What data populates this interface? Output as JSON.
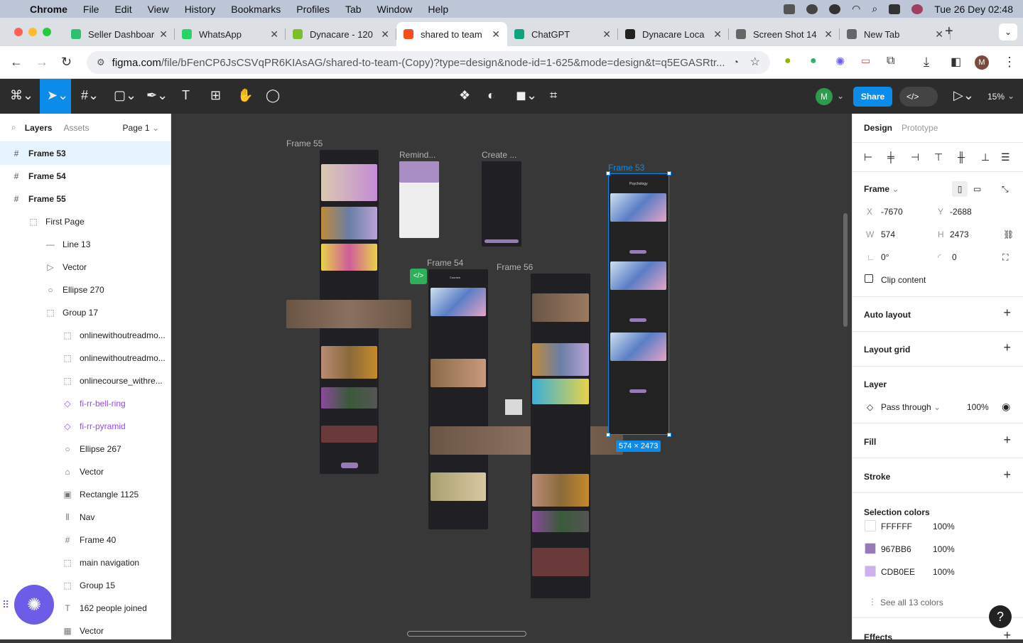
{
  "menubar": {
    "app": "Chrome",
    "items": [
      "File",
      "Edit",
      "View",
      "History",
      "Bookmarks",
      "Profiles",
      "Tab",
      "Window",
      "Help"
    ],
    "clock": "Tue 26 Dey  02:48"
  },
  "tabs": [
    {
      "title": "Seller Dashboard",
      "color": "#2fbf71"
    },
    {
      "title": "WhatsApp",
      "color": "#25d366"
    },
    {
      "title": "Dynacare - 120",
      "color": "#7cbf2c"
    },
    {
      "title": "shared to team",
      "color": "#f24e1e",
      "active": true
    },
    {
      "title": "ChatGPT",
      "color": "#10a37f"
    },
    {
      "title": "Dynacare Loca",
      "color": "#222222"
    },
    {
      "title": "Screen Shot 14",
      "color": "#666666"
    },
    {
      "title": "New Tab",
      "color": "#666666"
    }
  ],
  "address": {
    "host": "figma.com",
    "path": "/file/bFenCP6JsCSVqPR6KIAsAG/shared-to-team-(Copy)?type=design&node-id=1-625&mode=design&t=q5EGASRtr..."
  },
  "toolbar": {
    "share_label": "Share",
    "zoom": "15%",
    "avatar": "M"
  },
  "left_panel": {
    "tab_layers": "Layers",
    "tab_assets": "Assets",
    "page": "Page 1",
    "layers": [
      {
        "name": "Frame 53",
        "icon": "#",
        "bold": true,
        "selected": true,
        "indent": 0
      },
      {
        "name": "Frame 54",
        "icon": "#",
        "bold": true,
        "indent": 0
      },
      {
        "name": "Frame 55",
        "icon": "#",
        "bold": true,
        "indent": 0
      },
      {
        "name": "First Page",
        "icon": "⬚",
        "indent": 1
      },
      {
        "name": "Line 13",
        "icon": "—",
        "indent": 2
      },
      {
        "name": "Vector",
        "icon": "▷",
        "indent": 2
      },
      {
        "name": "Ellipse 270",
        "icon": "○",
        "indent": 2
      },
      {
        "name": "Group 17",
        "icon": "⬚",
        "indent": 2
      },
      {
        "name": "onlinewithoutreadmo...",
        "icon": "⬚",
        "indent": 3
      },
      {
        "name": "onlinewithoutreadmo...",
        "icon": "⬚",
        "indent": 3
      },
      {
        "name": "onlinecourse_withre...",
        "icon": "⬚",
        "indent": 3
      },
      {
        "name": "fi-rr-bell-ring",
        "icon": "◇",
        "purple": true,
        "indent": 3
      },
      {
        "name": "fi-rr-pyramid",
        "icon": "◇",
        "purple": true,
        "indent": 3
      },
      {
        "name": "Ellipse 267",
        "icon": "○",
        "indent": 3
      },
      {
        "name": "Vector",
        "icon": "⌂",
        "indent": 3
      },
      {
        "name": "Rectangle 1125",
        "icon": "▣",
        "indent": 3
      },
      {
        "name": "Nav",
        "icon": "⫴",
        "indent": 3
      },
      {
        "name": "Frame 40",
        "icon": "#",
        "indent": 3
      },
      {
        "name": "main navigation",
        "icon": "⬚",
        "indent": 3
      },
      {
        "name": "Group 15",
        "icon": "⬚",
        "indent": 3
      },
      {
        "name": "162 people joined",
        "icon": "T",
        "indent": 3
      },
      {
        "name": "Vector",
        "icon": "▦",
        "indent": 3
      }
    ]
  },
  "right_panel": {
    "tab_design": "Design",
    "tab_prototype": "Prototype",
    "frame_label": "Frame",
    "x_label": "X",
    "x": "-7670",
    "y_label": "Y",
    "y": "-2688",
    "w_label": "W",
    "w": "574",
    "h_label": "H",
    "h": "2473",
    "rotation": "0°",
    "radius": "0",
    "clip": "Clip content",
    "auto_layout": "Auto layout",
    "layout_grid": "Layout grid",
    "layer": "Layer",
    "blend": "Pass through",
    "opacity": "100%",
    "fill": "Fill",
    "stroke": "Stroke",
    "selection_colors": "Selection colors",
    "colors": [
      {
        "hex": "FFFFFF",
        "opacity": "100%",
        "swatch": "#FFFFFF"
      },
      {
        "hex": "967BB6",
        "opacity": "100%",
        "swatch": "#967BB6"
      },
      {
        "hex": "CDB0EE",
        "opacity": "100%",
        "swatch": "#CDB0EE"
      }
    ],
    "see_all": "See all 13 colors",
    "effects": "Effects"
  },
  "canvas": {
    "frame_labels": {
      "f55": "Frame 55",
      "remind": "Remind...",
      "create": "Create ...",
      "f54": "Frame 54",
      "f56": "Frame 56",
      "f53": "Frame 53"
    },
    "dimension_label": "574 × 2473",
    "f53_title": "Psychology",
    "f54_title": "Courses"
  }
}
